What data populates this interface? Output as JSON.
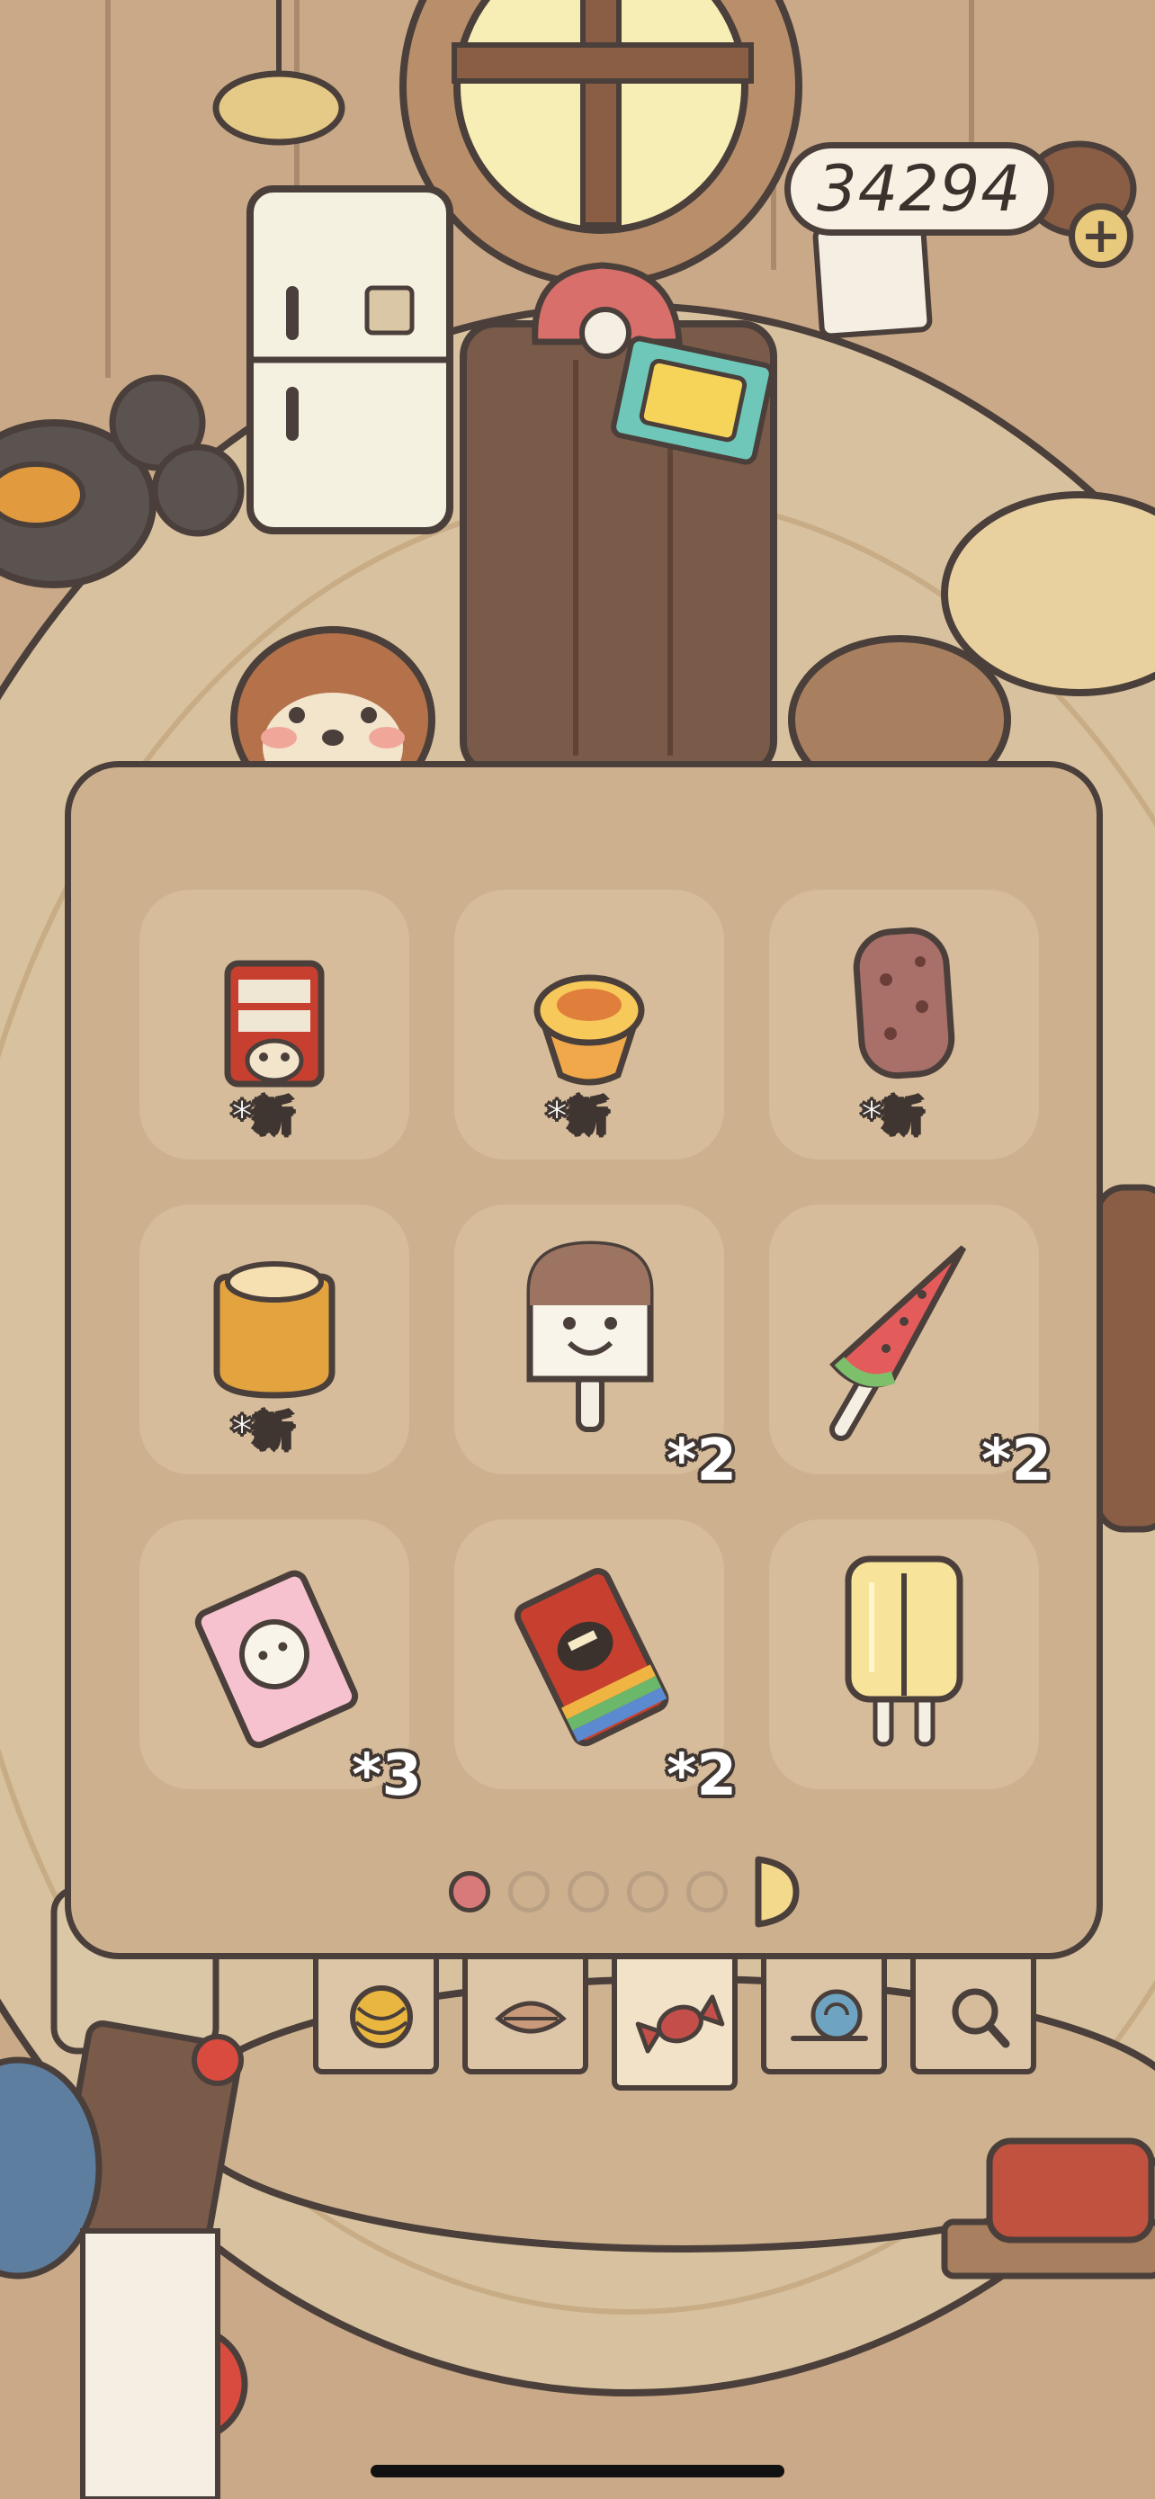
{
  "currency": {
    "amount": "34294",
    "add_icon": "plus-icon"
  },
  "inventory": {
    "slots": [
      {
        "name": "milk-carton",
        "icon": "milk-carton-icon",
        "badge": "*新"
      },
      {
        "name": "egg-tart",
        "icon": "egg-tart-icon",
        "badge": "*新"
      },
      {
        "name": "chocolate-popsicle",
        "icon": "chocolate-popsicle-icon",
        "badge": "*新"
      },
      {
        "name": "pudding-cup",
        "icon": "pudding-icon",
        "badge": "*新"
      },
      {
        "name": "smiley-popsicle",
        "icon": "smiley-popsicle-icon",
        "badge": "*2"
      },
      {
        "name": "watermelon-popsicle",
        "icon": "watermelon-popsicle-icon",
        "badge": "*2"
      },
      {
        "name": "pink-candy",
        "icon": "pink-candy-wrapper-icon",
        "badge": "*3"
      },
      {
        "name": "rainbow-candy",
        "icon": "rainbow-candy-wrapper-icon",
        "badge": "*2"
      },
      {
        "name": "double-popsicle",
        "icon": "double-popsicle-icon",
        "badge": ""
      }
    ],
    "pager": {
      "pages": 5,
      "current_page": 1,
      "next_icon": "next-page-icon"
    }
  },
  "category_tabs": [
    {
      "name": "yarn",
      "icon": "yarn-ball-icon",
      "active": false
    },
    {
      "name": "leaf",
      "icon": "leaf-icon",
      "active": false
    },
    {
      "name": "candy",
      "icon": "candy-icon",
      "active": true
    },
    {
      "name": "snail",
      "icon": "snail-icon",
      "active": false
    },
    {
      "name": "search",
      "icon": "magnifier-icon",
      "active": false
    }
  ],
  "colors": {
    "outline": "#4a3f3a",
    "panel": "#cdb08e",
    "slot": "#d6bc9b",
    "floor": "#d8c19e",
    "pager_active": "#d97a7a"
  }
}
